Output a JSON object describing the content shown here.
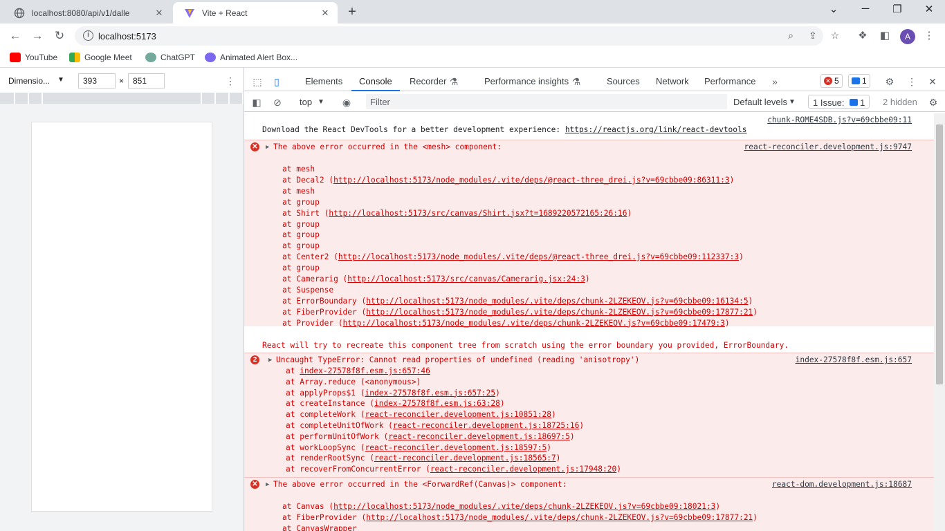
{
  "browser": {
    "tabs": [
      {
        "title": "localhost:8080/api/v1/dalle",
        "active": false
      },
      {
        "title": "Vite + React",
        "active": true
      }
    ],
    "url": "localhost:5173",
    "bookmarks": [
      "YouTube",
      "Google Meet",
      "ChatGPT",
      "Animated Alert Box..."
    ],
    "avatar_letter": "A",
    "icons": {
      "back": "←",
      "forward": "→",
      "reload": "↻",
      "new_tab": "+",
      "minimize": "─",
      "maximize": "❐",
      "close": "✕",
      "collapse": "⌄"
    }
  },
  "device_toolbar": {
    "device": "Dimensio...",
    "width": "393",
    "height": "851",
    "times": "×"
  },
  "devtools": {
    "tabs": [
      "Elements",
      "Console",
      "Recorder",
      "Performance insights",
      "Sources",
      "Network",
      "Performance"
    ],
    "active_tab": "Console",
    "error_count": "5",
    "message_count": "1",
    "console_bar": {
      "context": "top",
      "filter_placeholder": "Filter",
      "levels": "Default levels",
      "issues_label": "1 Issue:",
      "issues_count": "1",
      "hidden": "2 hidden"
    }
  },
  "console": {
    "devtools_msg": {
      "source": "chunk-ROME4SDB.js?v=69cbbe09:11",
      "text": "Download the React DevTools for a better development experience: ",
      "link": "https://reactjs.org/link/react-devtools"
    },
    "err1": {
      "title": "The above error occurred in the <mesh> component:",
      "source": "react-reconciler.development.js:9747",
      "stack": [
        {
          "fn": "at mesh",
          "url": ""
        },
        {
          "fn": "at Decal2 (",
          "url": "http://localhost:5173/node_modules/.vite/deps/@react-three_drei.js?v=69cbbe09:86311:3",
          "end": ")"
        },
        {
          "fn": "at mesh",
          "url": ""
        },
        {
          "fn": "at group",
          "url": ""
        },
        {
          "fn": "at Shirt (",
          "url": "http://localhost:5173/src/canvas/Shirt.jsx?t=1689220572165:26:16",
          "end": ")"
        },
        {
          "fn": "at group",
          "url": ""
        },
        {
          "fn": "at group",
          "url": ""
        },
        {
          "fn": "at group",
          "url": ""
        },
        {
          "fn": "at Center2 (",
          "url": "http://localhost:5173/node_modules/.vite/deps/@react-three_drei.js?v=69cbbe09:112337:3",
          "end": ")"
        },
        {
          "fn": "at group",
          "url": ""
        },
        {
          "fn": "at Camerarig (",
          "url": "http://localhost:5173/src/canvas/Camerarig.jsx:24:3",
          "end": ")"
        },
        {
          "fn": "at Suspense",
          "url": ""
        },
        {
          "fn": "at ErrorBoundary (",
          "url": "http://localhost:5173/node_modules/.vite/deps/chunk-2LZEKEOV.js?v=69cbbe09:16134:5",
          "end": ")"
        },
        {
          "fn": "at FiberProvider (",
          "url": "http://localhost:5173/node_modules/.vite/deps/chunk-2LZEKEOV.js?v=69cbbe09:17877:21",
          "end": ")"
        },
        {
          "fn": "at Provider (",
          "url": "http://localhost:5173/node_modules/.vite/deps/chunk-2LZEKEOV.js?v=69cbbe09:17479:3",
          "end": ")"
        }
      ],
      "footer": "React will try to recreate this component tree from scratch using the error boundary you provided, ErrorBoundary."
    },
    "err2": {
      "count": "2",
      "title": "Uncaught TypeError: Cannot read properties of undefined (reading 'anisotropy')",
      "source": "index-27578f8f.esm.js:657",
      "stack": [
        {
          "fn": "at ",
          "url": "index-27578f8f.esm.js:657:46",
          "end": ""
        },
        {
          "fn": "at Array.reduce (<anonymous>)",
          "url": ""
        },
        {
          "fn": "at applyProps$1 (",
          "url": "index-27578f8f.esm.js:657:25",
          "end": ")"
        },
        {
          "fn": "at createInstance (",
          "url": "index-27578f8f.esm.js:63:28",
          "end": ")"
        },
        {
          "fn": "at completeWork (",
          "url": "react-reconciler.development.js:10851:28",
          "end": ")"
        },
        {
          "fn": "at completeUnitOfWork (",
          "url": "react-reconciler.development.js:18725:16",
          "end": ")"
        },
        {
          "fn": "at performUnitOfWork (",
          "url": "react-reconciler.development.js:18697:5",
          "end": ")"
        },
        {
          "fn": "at workLoopSync (",
          "url": "react-reconciler.development.js:18597:5",
          "end": ")"
        },
        {
          "fn": "at renderRootSync (",
          "url": "react-reconciler.development.js:18565:7",
          "end": ")"
        },
        {
          "fn": "at recoverFromConcurrentError (",
          "url": "react-reconciler.development.js:17948:20",
          "end": ")"
        }
      ]
    },
    "err3": {
      "title": "The above error occurred in the <ForwardRef(Canvas)> component:",
      "source": "react-dom.development.js:18687",
      "stack": [
        {
          "fn": "at Canvas (",
          "url": "http://localhost:5173/node_modules/.vite/deps/chunk-2LZEKEOV.js?v=69cbbe09:18021:3",
          "end": ")"
        },
        {
          "fn": "at FiberProvider (",
          "url": "http://localhost:5173/node_modules/.vite/deps/chunk-2LZEKEOV.js?v=69cbbe09:17877:21",
          "end": ")"
        },
        {
          "fn": "at CanvasWrapper",
          "url": ""
        }
      ]
    }
  }
}
